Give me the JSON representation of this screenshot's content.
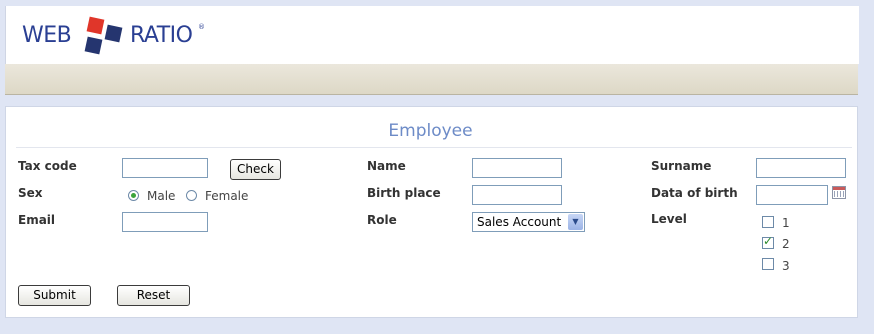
{
  "logo": {
    "left": "WEB",
    "right": "RATIO",
    "mark": "®",
    "colors": {
      "text": "#2a3f93",
      "red": "#e0362a",
      "navy": "#25356f"
    }
  },
  "form": {
    "title": "Employee",
    "fields": {
      "tax_code": {
        "label": "Tax code",
        "value": ""
      },
      "name": {
        "label": "Name",
        "value": ""
      },
      "surname": {
        "label": "Surname",
        "value": ""
      },
      "sex": {
        "label": "Sex",
        "options": [
          "Male",
          "Female"
        ],
        "selected": "Male"
      },
      "birth_place": {
        "label": "Birth place",
        "value": ""
      },
      "data_of_birth": {
        "label": "Data of birth",
        "value": ""
      },
      "email": {
        "label": "Email",
        "value": ""
      },
      "role": {
        "label": "Role",
        "selected": "Sales Account"
      },
      "level": {
        "label": "Level",
        "options": [
          "1",
          "2",
          "3"
        ],
        "checked": [
          "2"
        ]
      }
    },
    "buttons": {
      "check": "Check",
      "submit": "Submit",
      "reset": "Reset"
    }
  },
  "icons": {
    "calendar": "calendar-icon",
    "dropdown": "chevron-down-icon",
    "radio_on": "radio-selected",
    "check": "check-icon"
  },
  "colors": {
    "title": "#6d8bc7",
    "background": "#dfe5f4",
    "navbar": "#e5e1d3",
    "radio_dot": "#3ca43c"
  }
}
